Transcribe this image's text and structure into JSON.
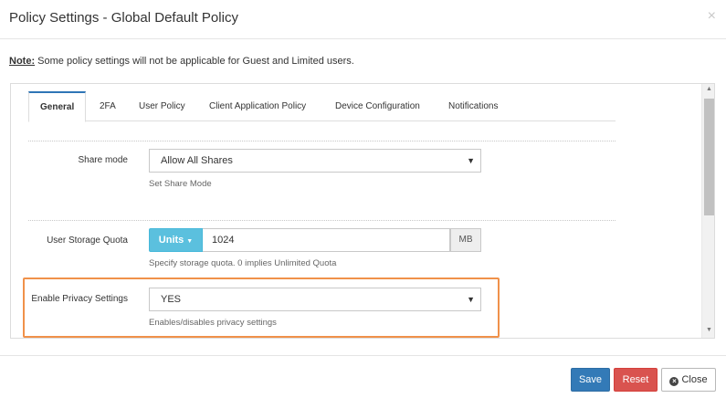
{
  "dialog": {
    "title": "Policy Settings - Global Default Policy",
    "close_glyph": "×"
  },
  "note": {
    "label": "Note:",
    "text": " Some policy settings will not be applicable for Guest and Limited users."
  },
  "tabs": [
    {
      "label": "General",
      "active": true
    },
    {
      "label": "2FA",
      "active": false
    },
    {
      "label": "User Policy",
      "active": false
    },
    {
      "label": "Client Application Policy",
      "active": false
    },
    {
      "label": "Device Configuration",
      "active": false
    },
    {
      "label": "Notifications",
      "active": false
    }
  ],
  "settings": {
    "share_mode": {
      "label": "Share mode",
      "value": "Allow All Shares",
      "help": "Set Share Mode"
    },
    "storage_quota": {
      "label": "User Storage Quota",
      "units_label": "Units",
      "value": "1024",
      "unit": "MB",
      "help": "Specify storage quota. 0 implies Unlimited Quota"
    },
    "privacy": {
      "label": "Enable Privacy Settings",
      "value": "YES",
      "help": "Enables/disables privacy settings"
    }
  },
  "footer": {
    "save_label": "Save",
    "reset_label": "Reset",
    "close_label": "Close"
  },
  "colors": {
    "primary": "#337ab7",
    "danger": "#d9534f",
    "info": "#5bc0de",
    "highlight": "#f0914a"
  }
}
